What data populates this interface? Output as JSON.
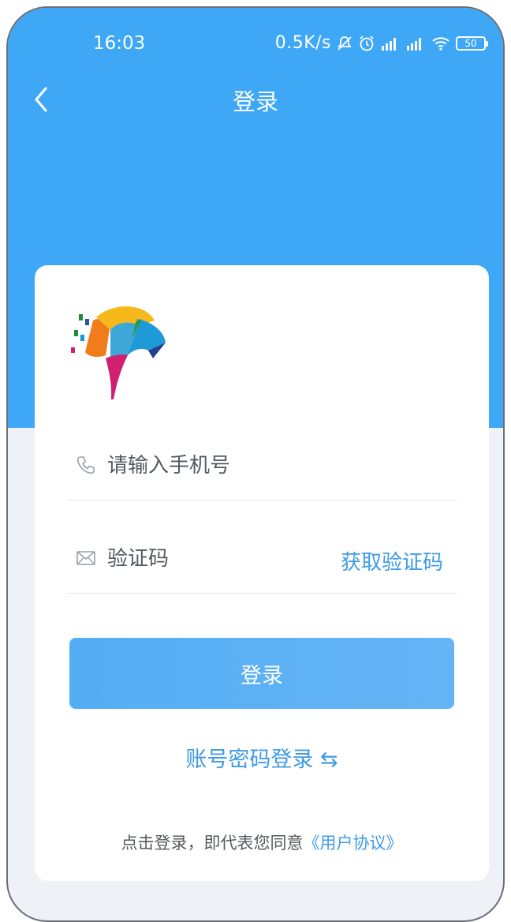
{
  "status_bar": {
    "time": "16:03",
    "network_speed": "0.5K/s",
    "battery": "50"
  },
  "nav": {
    "title": "登录"
  },
  "form": {
    "phone_placeholder": "请输入手机号",
    "code_placeholder": "验证码",
    "get_code_label": "获取验证码",
    "login_button": "登录",
    "alt_login": "账号密码登录 ⇆"
  },
  "agreement": {
    "prefix": "点击登录，即代表您同意",
    "link": "《用户协议》"
  },
  "colors": {
    "header_blue": "#3ea7f6",
    "accent": "#3f9be6",
    "button": "#5aaff4"
  }
}
